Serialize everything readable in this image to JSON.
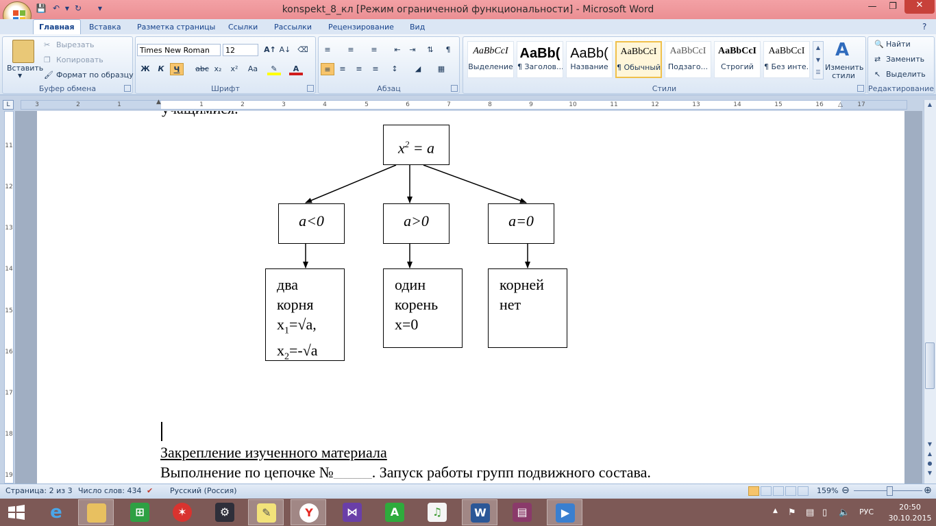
{
  "window": {
    "title": "konspekt_8_кл [Режим ограниченной функциональности] - Microsoft Word",
    "minimize_icon": "minimize-icon",
    "maximize_icon": "restore-icon",
    "close_icon": "close-icon"
  },
  "tabs": [
    "Главная",
    "Вставка",
    "Разметка страницы",
    "Ссылки",
    "Рассылки",
    "Рецензирование",
    "Вид"
  ],
  "ribbon": {
    "clipboard": {
      "label": "Буфер обмена",
      "paste": "Вставить",
      "cut": "Вырезать",
      "copy": "Копировать",
      "format_painter": "Формат по образцу"
    },
    "font": {
      "label": "Шрифт",
      "font_name": "Times New Roman",
      "font_size": "12",
      "bold": "Ж",
      "italic": "К",
      "underline": "Ч",
      "strike": "abc",
      "sub": "x₂",
      "sup": "x²",
      "case": "Aa"
    },
    "paragraph": {
      "label": "Абзац"
    },
    "styles": {
      "label": "Стили",
      "items": [
        {
          "sample": "AaBbCcI",
          "name": "Выделение"
        },
        {
          "sample": "AaBb(",
          "name": "¶ Заголов..."
        },
        {
          "sample": "AaBb(",
          "name": "Название"
        },
        {
          "sample": "AaBbCcI",
          "name": "¶ Обычный"
        },
        {
          "sample": "AaBbCcI",
          "name": "Подзаго..."
        },
        {
          "sample": "AaBbCcI",
          "name": "Строгий"
        },
        {
          "sample": "AaBbCcI",
          "name": "¶ Без инте..."
        }
      ],
      "change_styles": "Изменить стили"
    },
    "editing": {
      "label": "Редактирование",
      "find": "Найти",
      "replace": "Заменить",
      "select": "Выделить"
    }
  },
  "ruler": {
    "h_numbers": [
      "3",
      "2",
      "1",
      "1",
      "2",
      "3",
      "4",
      "5",
      "6",
      "7",
      "8",
      "9",
      "10",
      "11",
      "12",
      "13",
      "14",
      "15",
      "16",
      "17"
    ],
    "v_numbers": [
      "11",
      "12",
      "13",
      "14",
      "15",
      "16",
      "17",
      "18",
      "19"
    ]
  },
  "document": {
    "clipped_line": "учащимися.",
    "diagram": {
      "root": {
        "var": "x",
        "exp": "2",
        "rest": " = a"
      },
      "cases": [
        "a<0",
        "a>0",
        "a=0"
      ],
      "result_neg": {
        "l1": "два",
        "l2": "корня",
        "l3a": "x",
        "l3s": "1",
        "l3b": "=√a,",
        "l4a": "x",
        "l4s": "2",
        "l4b": "=-√a"
      },
      "result_pos": {
        "l1": "один",
        "l2": "корень",
        "l3": "x=0"
      },
      "result_zero": {
        "l1": "корней",
        "l2": "нет"
      }
    },
    "heading": "Закрепление изученного материала",
    "line_a": "Выполнение по цепочке №",
    "line_blank": "________",
    "line_b": ". Запуск работы групп подвижного состава."
  },
  "status": {
    "page": "Страница: 2 из 3",
    "words": "Число слов: 434",
    "language": "Русский (Россия)",
    "zoom": "159%"
  },
  "taskbar": {
    "apps": [
      "ie-icon",
      "file-explorer-icon",
      "store-icon",
      "app-icon",
      "tools-icon",
      "sticky-notes-icon",
      "yandex-icon",
      "visual-studio-icon",
      "abbyy-icon",
      "music-icon",
      "word-icon",
      "winrar-icon",
      "media-icon"
    ],
    "lang": "РУС",
    "time": "20:50",
    "date": "30.10.2015"
  }
}
